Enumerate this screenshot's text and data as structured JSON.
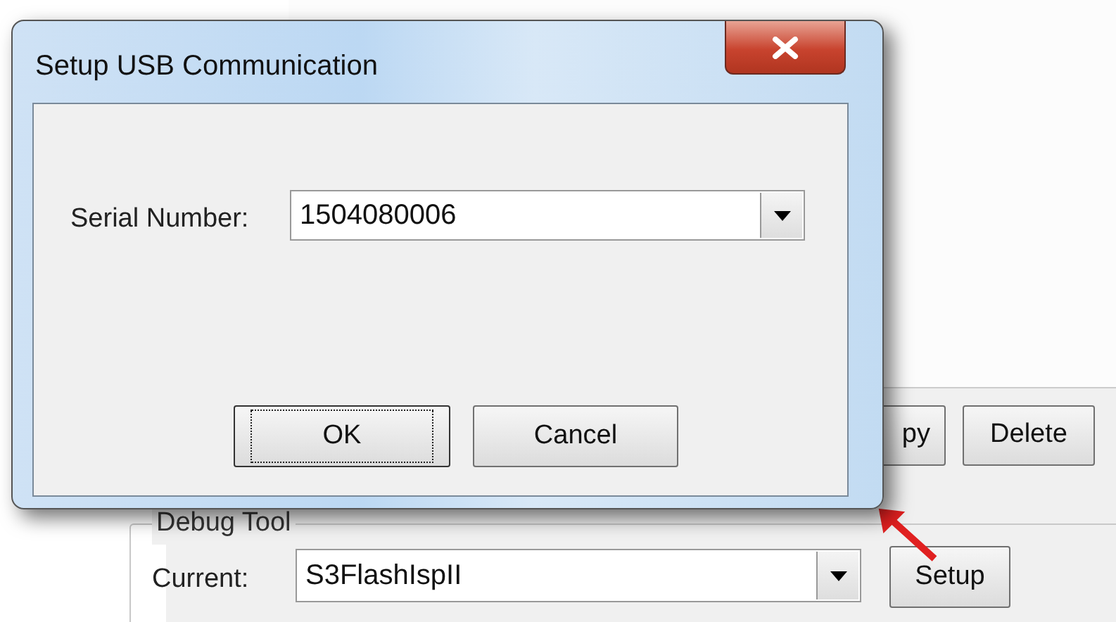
{
  "dialog": {
    "title": "Setup USB Communication",
    "serial_number": {
      "label": "Serial Number:",
      "value": "1504080006"
    },
    "buttons": [
      {
        "label": "OK",
        "focused": true
      },
      {
        "label": "Cancel",
        "focused": false
      }
    ]
  },
  "background": {
    "buttons": [
      {
        "label": "py"
      },
      {
        "label": "Delete"
      }
    ],
    "debug_tool": {
      "title": "Debug Tool",
      "label": "Current:",
      "value": "S3FlashIspII",
      "button": "Setup"
    }
  }
}
